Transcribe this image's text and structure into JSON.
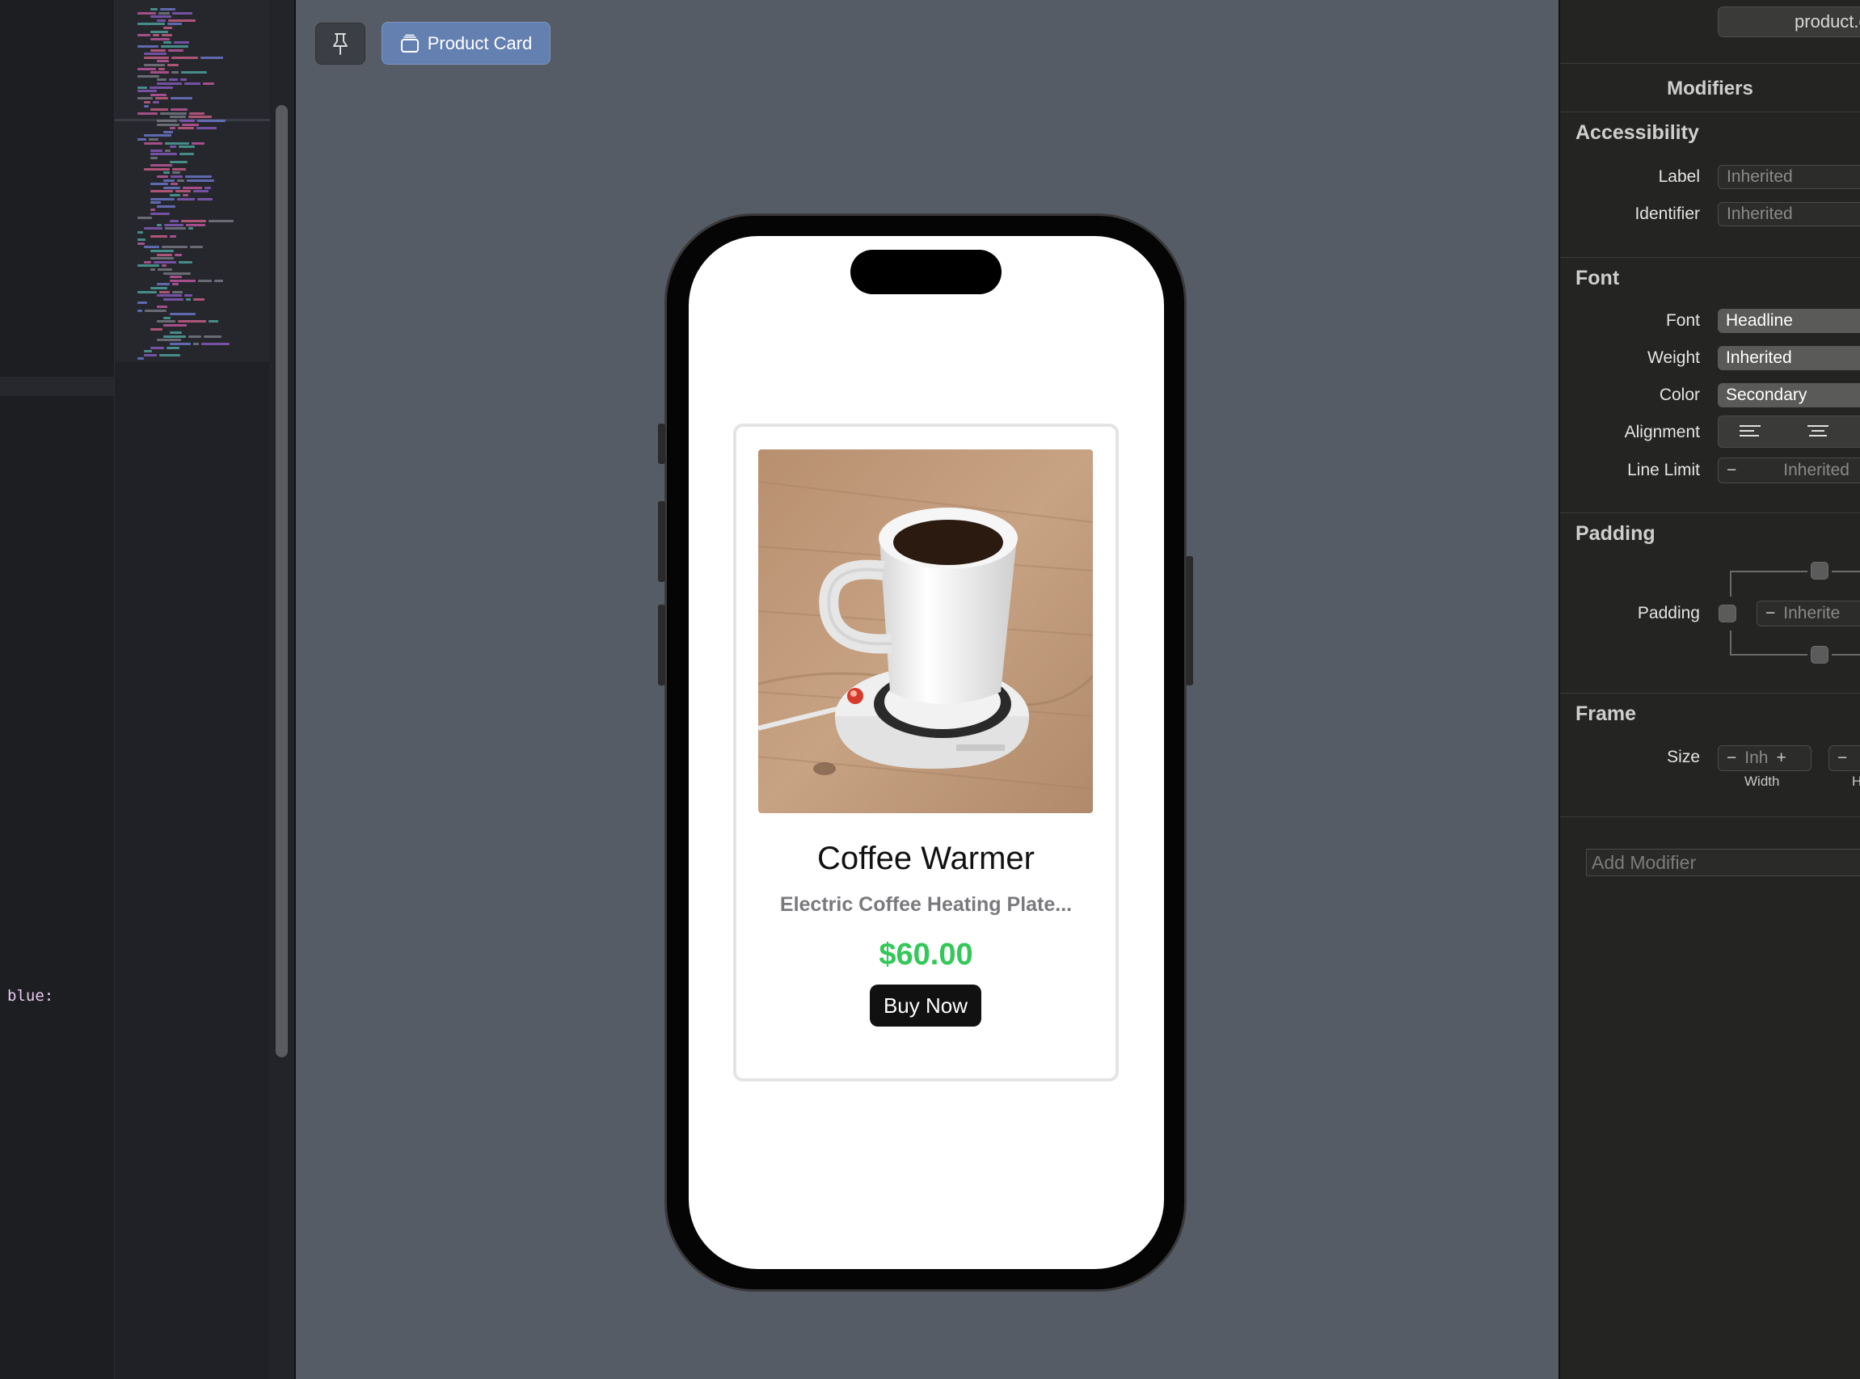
{
  "editor": {
    "code_fragment": "blue:"
  },
  "canvas": {
    "pin_icon": "pin-icon",
    "preview_tab": {
      "icon": "product-card-icon",
      "label": "Product Card"
    }
  },
  "product": {
    "title": "Coffee Warmer",
    "subtitle": "Electric Coffee Heating Plate...",
    "price": "$60.00",
    "button_label": "Buy Now",
    "price_color": "#34c759"
  },
  "inspector": {
    "top_field": "product.de",
    "modifiers_title": "Modifiers",
    "accessibility": {
      "title": "Accessibility",
      "label_label": "Label",
      "label_placeholder": "Inherited",
      "identifier_label": "Identifier",
      "identifier_placeholder": "Inherited"
    },
    "font": {
      "title": "Font",
      "font_label": "Font",
      "font_value": "Headline",
      "weight_label": "Weight",
      "weight_value": "Inherited",
      "color_label": "Color",
      "color_value": "Secondary",
      "alignment_label": "Alignment",
      "line_limit_label": "Line Limit",
      "line_limit_value": "Inherited",
      "minus": "−"
    },
    "padding": {
      "title": "Padding",
      "padding_label": "Padding",
      "padding_value": "Inherite",
      "minus": "−"
    },
    "frame": {
      "title": "Frame",
      "size_label": "Size",
      "width_value": "Inh",
      "minus": "−",
      "plus": "+",
      "width_caption": "Width",
      "height_caption": "H"
    },
    "add_modifier_placeholder": "Add Modifier"
  }
}
